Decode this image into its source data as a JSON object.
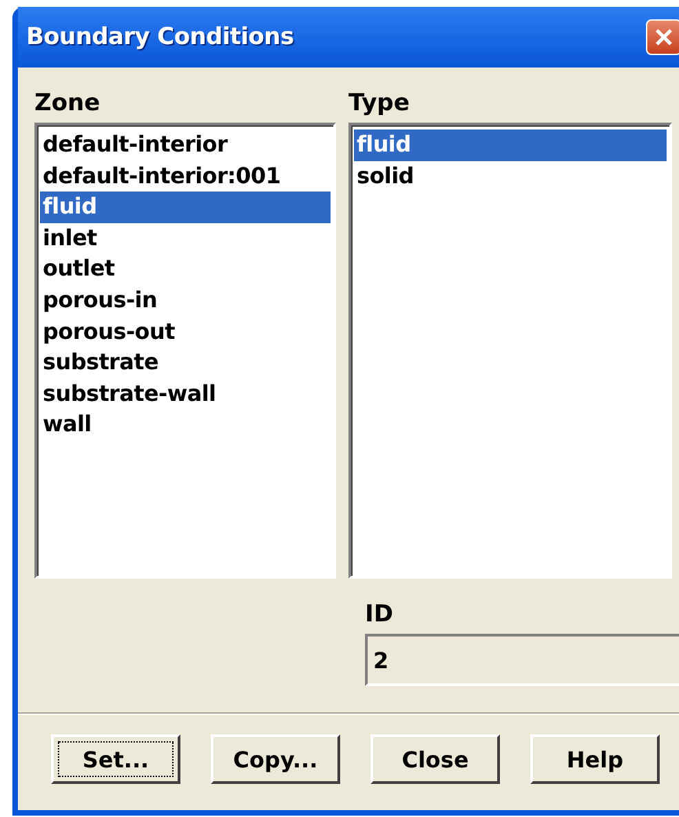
{
  "window": {
    "title": "Boundary Conditions"
  },
  "zone": {
    "label": "Zone",
    "items": [
      {
        "label": "default-interior",
        "selected": false
      },
      {
        "label": "default-interior:001",
        "selected": false
      },
      {
        "label": "fluid",
        "selected": true
      },
      {
        "label": "inlet",
        "selected": false
      },
      {
        "label": "outlet",
        "selected": false
      },
      {
        "label": "porous-in",
        "selected": false
      },
      {
        "label": "porous-out",
        "selected": false
      },
      {
        "label": "substrate",
        "selected": false
      },
      {
        "label": "substrate-wall",
        "selected": false
      },
      {
        "label": "wall",
        "selected": false
      }
    ]
  },
  "type": {
    "label": "Type",
    "items": [
      {
        "label": "fluid",
        "selected": true
      },
      {
        "label": "solid",
        "selected": false
      }
    ]
  },
  "id": {
    "label": "ID",
    "value": "2"
  },
  "buttons": [
    {
      "label": "Set...",
      "focused": true
    },
    {
      "label": "Copy...",
      "focused": false
    },
    {
      "label": "Close",
      "focused": false
    },
    {
      "label": "Help",
      "focused": false
    }
  ]
}
